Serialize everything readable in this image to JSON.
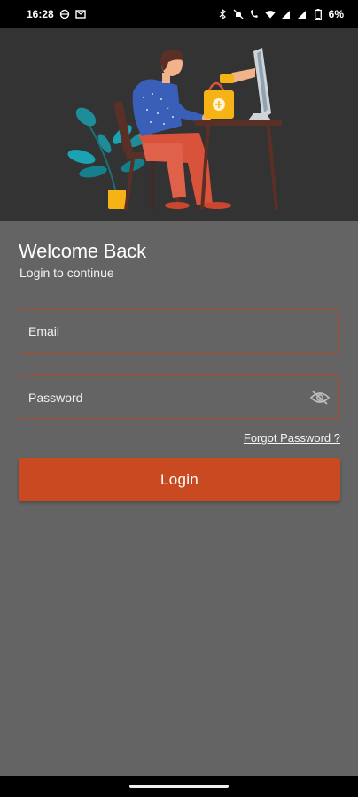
{
  "status_bar": {
    "time": "16:28",
    "battery": "6%",
    "icons": [
      "vpn-icon",
      "mail-icon",
      "bluetooth-icon",
      "mute-icon",
      "wifi-call-icon",
      "wifi-icon",
      "signal-icon",
      "signal-icon-2",
      "battery-icon"
    ]
  },
  "login": {
    "title": "Welcome Back",
    "subtitle": "Login to continue",
    "email_placeholder": "Email",
    "password_placeholder": "Password",
    "forgot_label": "Forgot Password ?",
    "button_label": "Login"
  },
  "colors": {
    "accent": "#c94a21",
    "field_border": "#a8492a",
    "background": "#646464",
    "hero_background": "#333333"
  }
}
